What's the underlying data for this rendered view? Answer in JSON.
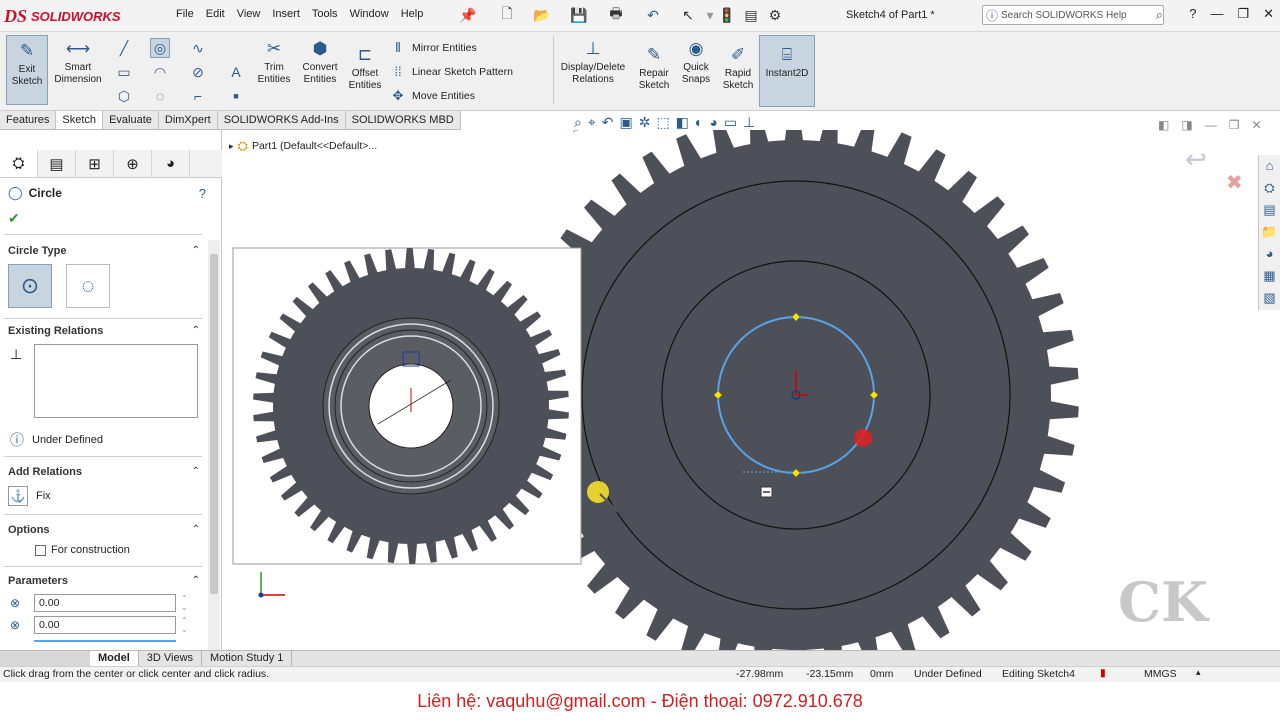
{
  "app": {
    "logo_mark": "DS",
    "logo_text": "SOLIDWORKS",
    "doc_title": "Sketch4 of Part1 *"
  },
  "menu": [
    "File",
    "Edit",
    "View",
    "Insert",
    "Tools",
    "Window",
    "Help"
  ],
  "search": {
    "placeholder": "Search SOLIDWORKS Help"
  },
  "ribbon": {
    "exit_sketch": "Exit Sketch",
    "smart_dimension": "Smart Dimension",
    "trim_entities": "Trim Entities",
    "convert_entities": "Convert Entities",
    "offset_entities": "Offset Entities",
    "mirror_entities": "Mirror Entities",
    "linear_sketch_pattern": "Linear Sketch Pattern",
    "move_entities": "Move Entities",
    "display_delete_relations": "Display/Delete Relations",
    "repair_sketch": "Repair Sketch",
    "quick_snaps": "Quick Snaps",
    "rapid_sketch": "Rapid Sketch",
    "instant2d": "Instant2D"
  },
  "command_tabs": [
    "Features",
    "Sketch",
    "Evaluate",
    "DimXpert",
    "SOLIDWORKS Add-Ins",
    "SOLIDWORKS MBD"
  ],
  "active_command_tab": "Sketch",
  "property_manager": {
    "title": "Circle",
    "circle_type": "Circle Type",
    "existing_relations": "Existing Relations",
    "status": "Under Defined",
    "add_relations": "Add Relations",
    "fix": "Fix",
    "options": "Options",
    "for_construction": "For construction",
    "parameters": "Parameters",
    "cx": "0.00",
    "cy": "0.00"
  },
  "feature_tree": {
    "item": "Part1  (Default<<Default>..."
  },
  "bottom_tabs": [
    "Model",
    "3D Views",
    "Motion Study 1"
  ],
  "status": {
    "hint": "Click drag from the center or click center and click radius.",
    "x": "-27.98mm",
    "y": "-23.15mm",
    "z": "0mm",
    "defined": "Under Defined",
    "editing": "Editing Sketch4",
    "units": "MMGS"
  },
  "footer": "Liên hệ: vaquhu@gmail.com - Điện thoại: 0972.910.678",
  "colors": {
    "accent": "#2b5b8a",
    "gear": "#4d5058",
    "sketch_circle": "#5aa3e8",
    "footer_text": "#d21f1f"
  }
}
